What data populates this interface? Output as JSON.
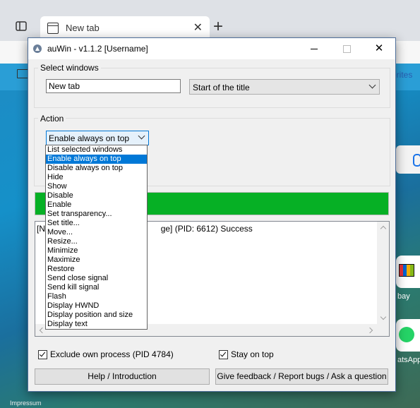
{
  "browser": {
    "tab_title": "New tab",
    "favorites_label": "orites",
    "tile_ebay_label": "bay",
    "tile_whatsapp_label": "atsApp",
    "footer_link": "Impressum"
  },
  "window": {
    "title": "auWin - v1.1.2 [Username]",
    "close_glyph": "✕"
  },
  "select_windows": {
    "group_label": "Select windows",
    "title_input_value": "New tab",
    "match_mode_value": "Start of the title"
  },
  "action": {
    "group_label": "Action",
    "selected_value": "Enable always on top",
    "options": [
      "List selected windows",
      "Enable always on top",
      "Disable always on top",
      "Hide",
      "Show",
      "Disable",
      "Enable",
      "Set transparency...",
      "Set title...",
      "Move...",
      "Resize...",
      "Minimize",
      "Maximize",
      "Restore",
      "Send close signal",
      "Send kill signal",
      "Flash",
      "Display HWND",
      "Display position and size",
      "Display text"
    ],
    "highlighted_index": 1
  },
  "progress": {
    "fraction": 1.0,
    "color": "#06b025"
  },
  "log": {
    "visible_prefix": "[Ne",
    "visible_suffix": "ge] (PID: 6612) Success"
  },
  "options": {
    "exclude_own_process_label": "Exclude own process (PID 4784)",
    "exclude_own_process_checked": true,
    "stay_on_top_label": "Stay on top",
    "stay_on_top_checked": true
  },
  "buttons": {
    "help_label": "Help / Introduction",
    "feedback_label": "Give feedback / Report bugs / Ask a question"
  },
  "colors": {
    "accent": "#0078d7",
    "progress_green": "#06b025"
  }
}
